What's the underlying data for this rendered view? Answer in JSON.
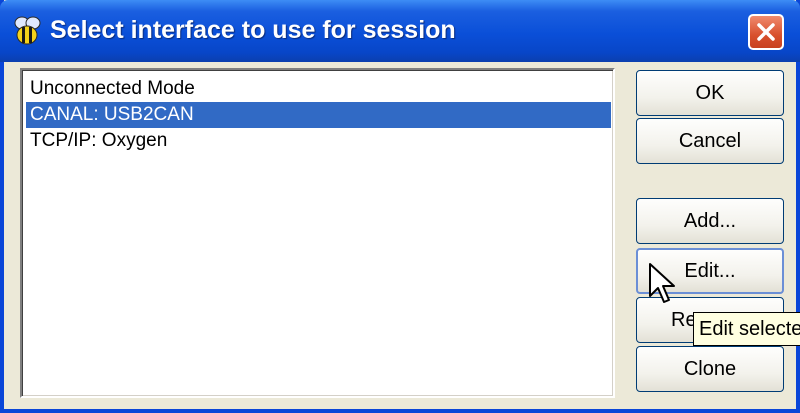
{
  "window": {
    "title": "Select interface to use for session"
  },
  "interfaces": [
    {
      "label": "Unconnected Mode",
      "selected": false
    },
    {
      "label": "CANAL: USB2CAN",
      "selected": true
    },
    {
      "label": "TCP/IP: Oxygen",
      "selected": false
    }
  ],
  "buttons": {
    "ok": "OK",
    "cancel": "Cancel",
    "add": "Add...",
    "edit": "Edit...",
    "remove": "Re",
    "clone": "Clone"
  },
  "tooltip": {
    "text": "Edit selecte"
  },
  "colors": {
    "titlebar": "#0a4fd8",
    "selection": "#316ac5",
    "close_button": "#d8502d",
    "tooltip_bg": "#ffffe1"
  },
  "icons": {
    "app": "bee-icon",
    "close": "close-icon",
    "cursor": "arrow-cursor-icon"
  }
}
